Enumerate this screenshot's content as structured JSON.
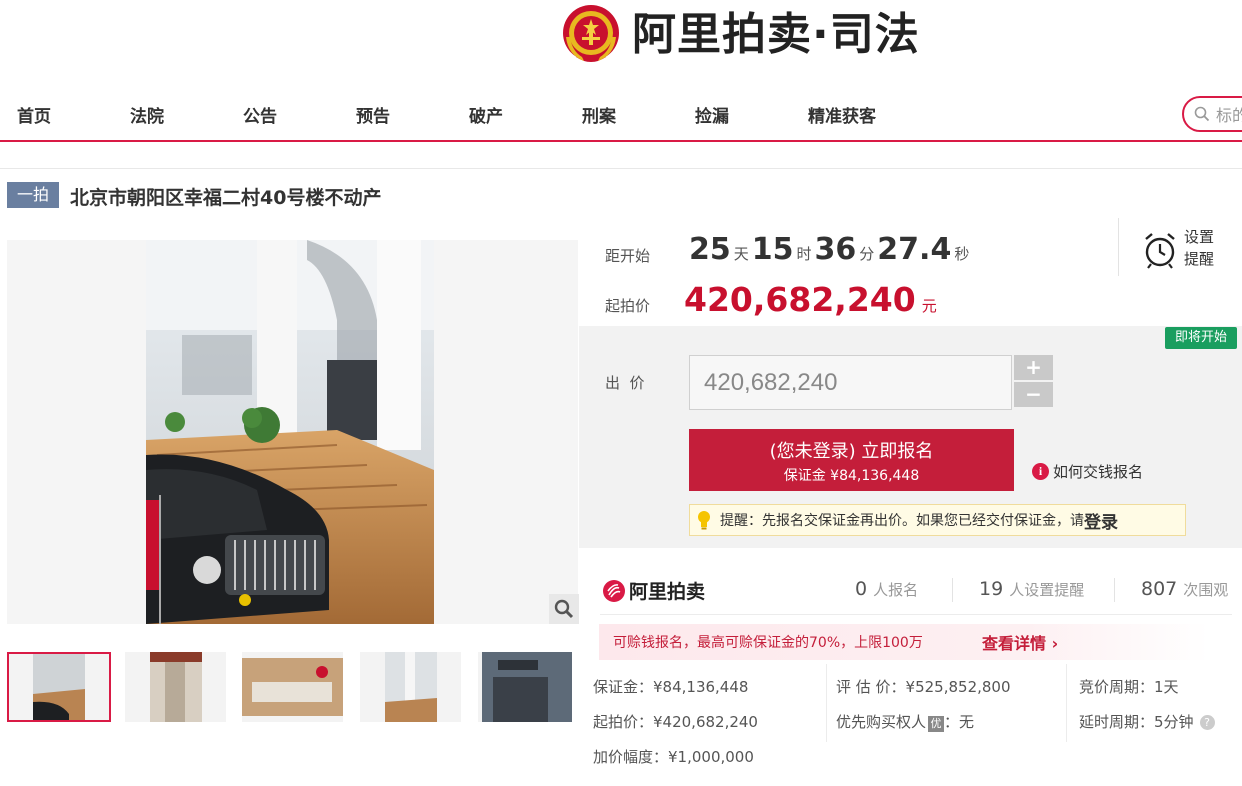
{
  "header": {
    "logo_text": "阿里拍卖·司法"
  },
  "nav": {
    "items": [
      "首页",
      "法院",
      "公告",
      "预告",
      "破产",
      "刑案",
      "捡漏",
      "精准获客"
    ],
    "search_placeholder": "标的"
  },
  "item": {
    "badge": "一拍",
    "title": "北京市朝阳区幸福二村40号楼不动产"
  },
  "countdown": {
    "label": "距开始",
    "days": "25",
    "days_unit": "天",
    "hours": "15",
    "hours_unit": "时",
    "minutes": "36",
    "minutes_unit": "分",
    "seconds": "27.4",
    "seconds_unit": "秒"
  },
  "remind": {
    "label": "设置提醒"
  },
  "start_price": {
    "label": "起拍价",
    "value": "420,682,240",
    "unit": "元"
  },
  "bid": {
    "status_badge": "即将开始",
    "label": "出  价",
    "input_value": "420,682,240",
    "plus": "+",
    "minus": "−",
    "register_line1": "(您未登录) 立即报名",
    "register_line2": "保证金 ¥84,136,448",
    "howto": "如何交钱报名",
    "tip_text": "提醒：先报名交保证金再出价。如果您已经交付保证金，请",
    "tip_login": "登录"
  },
  "stats": {
    "brand": "阿里拍卖",
    "signups": "0",
    "signups_unit": "人报名",
    "reminders": "19",
    "reminders_unit": "人设置提醒",
    "views": "807",
    "views_unit": "次围观"
  },
  "loan": {
    "text": "可赊钱报名，最高可赊保证金的70%，上限100万",
    "detail": "查看详情"
  },
  "info": {
    "deposit": "保证金：¥84,136,448",
    "start_price": "起拍价：¥420,682,240",
    "increment": "加价幅度：¥1,000,000",
    "appraisal": "评 估 价：¥525,852,800",
    "priority_label": "优先购买权人",
    "priority_tag": "优",
    "priority_value": "：无",
    "period": "竞价周期：1天",
    "delay": "延时周期：5分钟",
    "help": "?"
  },
  "colors": {
    "brand_red": "#d91a45",
    "price_red": "#c8102e",
    "button_red": "#c41e3a",
    "status_green": "#1a9e5f"
  }
}
